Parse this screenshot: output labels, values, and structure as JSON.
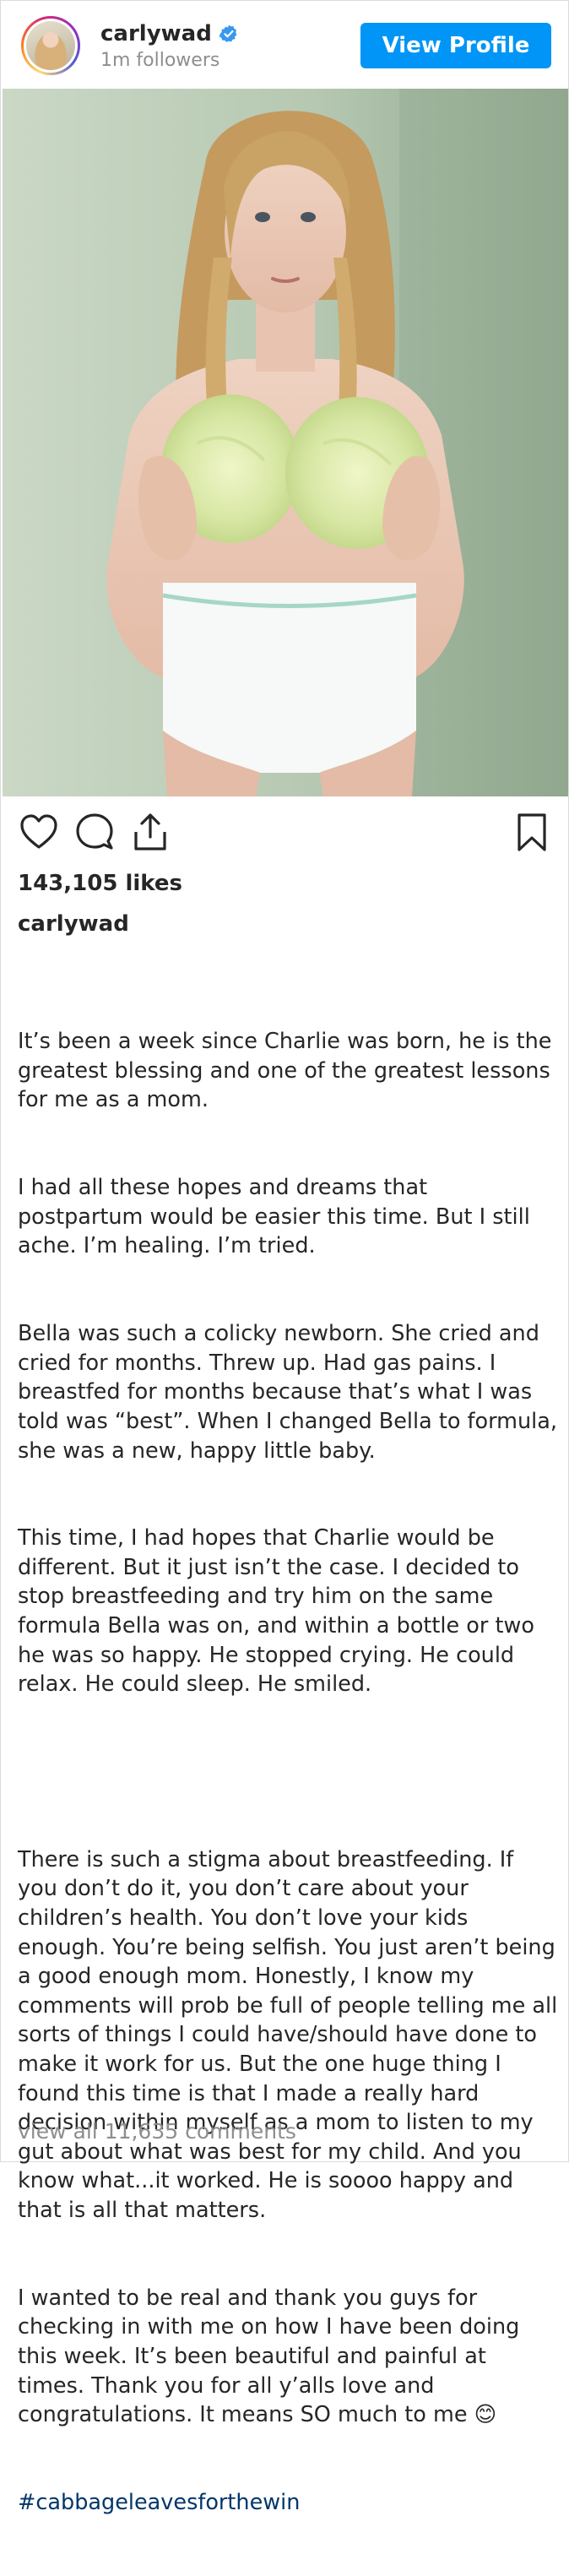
{
  "header": {
    "username": "carlywad",
    "followers": "1m followers",
    "view_profile_label": "View Profile"
  },
  "post": {
    "likes": "143,105 likes",
    "caption_user": "carlywad",
    "caption_paragraphs": [
      "It’s been a week since Charlie was born, he is the greatest blessing and one of the greatest lessons for me as a mom.",
      "I had all these hopes and dreams that postpartum would be easier this time. But I still ache. I’m healing. I’m tried.",
      "Bella was such a colicky newborn. She cried and cried for months. Threw up. Had gas pains. I breastfed for months because that’s what I was told was “best”. When I changed Bella to formula, she was a new, happy little baby.",
      "This time, I had hopes that Charlie would be different. But it just isn’t the case. I decided to stop breastfeeding and try him on the same formula Bella was on, and within a bottle or two he was so happy. He stopped crying. He could relax. He could sleep. He smiled.",
      "",
      "There is such a stigma about breastfeeding. If you don’t do it, you don’t care about your children’s health. You don’t love your kids enough. You’re being selfish. You just aren’t being a good enough mom. Honestly, I know my comments will prob be full of people telling me all sorts of things I could have/should have done to make it work for us. But the one huge thing I found this time is that I made a really hard decision within myself as a mom to listen to my gut about what was best for my child. And you know what...it worked. He is soooo happy and that is all that matters.",
      "I wanted to be real and thank you guys for checking in with me on how I have been doing this week. It’s been beautiful and painful at times. Thank you for all y’alls love and congratulations. It means SO much to me 😊"
    ],
    "hashtag": "#cabbageleavesforthewin",
    "view_comments": "view all 11,635 comments"
  },
  "icons": {
    "verified": "verified-badge-icon",
    "like": "heart-icon",
    "comment": "comment-icon",
    "share": "share-icon",
    "save": "bookmark-icon"
  },
  "colors": {
    "accent": "#0095f6",
    "verified": "#3897f0",
    "muted": "#8e8e8e",
    "text": "#262626",
    "hashtag": "#00376b"
  }
}
